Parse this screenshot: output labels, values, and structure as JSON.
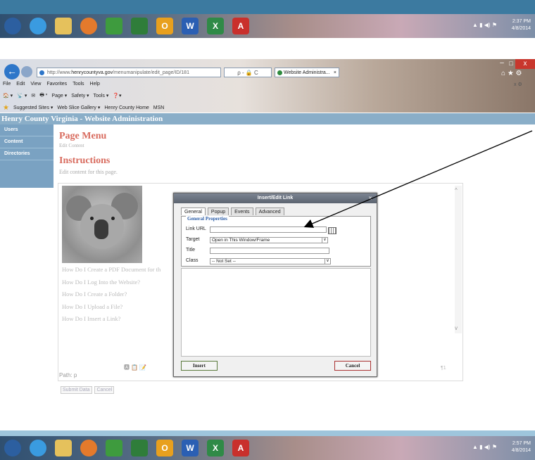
{
  "taskbar": {
    "time_top": "2:37 PM",
    "date_top": "4/8/2014",
    "time_bottom": "2:57 PM",
    "date_bottom": "4/8/2014",
    "tray_icons": "▲ ▮ ◀) ⚑",
    "apps": [
      "ie-icon",
      "folder-icon",
      "media-icon",
      "chrome-icon",
      "screen-icon",
      "outlook-icon",
      "word-icon",
      "excel-icon",
      "acrobat-icon"
    ],
    "app_glyphs": [
      "",
      "",
      "",
      "",
      "",
      "O",
      "W",
      "X",
      "A"
    ]
  },
  "browser": {
    "back_glyph": "←",
    "url_prefix": "http://www.",
    "url_domain": "henrycountyva.gov",
    "url_path": "/menumanipulate/edit_page/ID/181",
    "addr_tools": "ρ - 🔒 C",
    "tab_title": "Website Administra...",
    "tab_close": "×",
    "menus": [
      "File",
      "Edit",
      "View",
      "Favorites",
      "Tools",
      "Help"
    ],
    "commands": [
      "🏠 ▾",
      "📡 ▾",
      "✉",
      "🖶 ▾",
      "Page ▾",
      "Safety ▾",
      "Tools ▾",
      "❓▾"
    ],
    "favorites": [
      "Suggested Sites ▾",
      "Web Slice Gallery ▾",
      "Henry County Home",
      "MSN"
    ],
    "win_min": "–",
    "win_max": "□",
    "win_close": "x",
    "home_glyphs": "⌂ ★ ⚙",
    "right_mini": "x ⚙"
  },
  "site": {
    "header": "Henry County Virginia - Website Administration",
    "sidebar": [
      "Users",
      "Content",
      "Directories"
    ],
    "page_title": "Page Menu",
    "page_sub": "Edit Content",
    "instructions_title": "Instructions",
    "instructions_text": "Edit content for this page.",
    "links": [
      "How Do I Create a PDF Document for th",
      "How Do I Log Into the Website?",
      "How Do I Create a Folder?",
      "How Do I Upload a File?",
      "How Do I Insert a Link?"
    ],
    "editor_toolbar": "🅰 📋 📝",
    "path": "Path: p",
    "path_right": "¶1",
    "scroll_up": "^",
    "scroll_down": "v",
    "submit": "Submit Data",
    "cancel": "Cancel"
  },
  "dialog": {
    "title": "Insert/Edit Link",
    "close": "x",
    "tabs": [
      "General",
      "Popup",
      "Events",
      "Advanced"
    ],
    "legend": "General Properties",
    "fields": {
      "link_url_label": "Link URL",
      "link_url_value": "",
      "target_label": "Target",
      "target_value": "Open in This Window/Frame",
      "title_label": "Title",
      "title_value": "",
      "class_label": "Class",
      "class_value": "-- Not Set --"
    },
    "select_arrow": "∨",
    "insert": "Insert",
    "cancel": "Cancel"
  },
  "colors": {
    "accent_title": "#d86b5e",
    "header_bg": "#8aaec8",
    "sidebar_bg": "#7aa2c2",
    "legend": "#2c5ea8"
  }
}
